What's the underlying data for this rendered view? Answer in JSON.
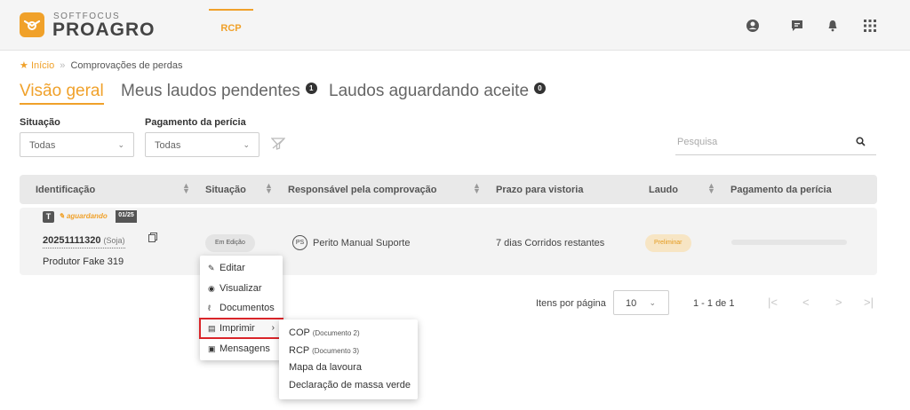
{
  "brand": {
    "small": "SOFTFOCUS",
    "big": "PROAGRO"
  },
  "header": {
    "nav_active": "RCP",
    "icons": [
      "user-circle-icon",
      "chat-icon",
      "bell-icon",
      "apps-grid-icon"
    ]
  },
  "breadcrumb": {
    "home": "Início",
    "current": "Comprovações de perdas"
  },
  "tabs": [
    {
      "label": "Visão geral",
      "active": true
    },
    {
      "label": "Meus laudos pendentes",
      "badge": "1"
    },
    {
      "label": "Laudos aguardando aceite",
      "badge": "0"
    }
  ],
  "filters": {
    "situacao": {
      "label": "Situação",
      "value": "Todas"
    },
    "pagamento": {
      "label": "Pagamento da perícia",
      "value": "Todas"
    }
  },
  "search": {
    "placeholder": "Pesquisa"
  },
  "table": {
    "columns": [
      "Identificação",
      "Situação",
      "Responsável pela comprovação",
      "Prazo para vistoria",
      "Laudo",
      "Pagamento da perícia"
    ],
    "row": {
      "type_badge": "T",
      "status_tag": "aguardando",
      "date_tag": "01/25",
      "id": "20251111320",
      "crop": "(Soja)",
      "producer": "Produtor Fake 319",
      "situacao": "Em Edição",
      "resp_initials": "PS",
      "responsavel": "Perito Manual Suporte",
      "prazo": "7 dias Corridos restantes",
      "laudo": "Preliminar"
    }
  },
  "pagination": {
    "label": "Itens por página",
    "per_page": "10",
    "range": "1 - 1 de 1",
    "nav": [
      "|<",
      "<",
      ">",
      ">|"
    ]
  },
  "context_menu": {
    "items": [
      {
        "label": "Editar",
        "icon": "pencil-icon"
      },
      {
        "label": "Visualizar",
        "icon": "eye-icon"
      },
      {
        "label": "Documentos",
        "icon": "paperclip-icon"
      },
      {
        "label": "Imprimir",
        "icon": "printer-icon",
        "has_submenu": true,
        "highlighted": true
      },
      {
        "label": "Mensagens",
        "icon": "message-icon"
      }
    ],
    "submenu": [
      {
        "label": "COP",
        "sub": "(Documento 2)"
      },
      {
        "label": "RCP",
        "sub": "(Documento 3)"
      },
      {
        "label": "Mapa da lavoura",
        "sub": ""
      },
      {
        "label": "Declaração de massa verde",
        "sub": ""
      }
    ]
  },
  "colors": {
    "accent": "#f0a12a",
    "highlight_border": "#d9252a"
  }
}
